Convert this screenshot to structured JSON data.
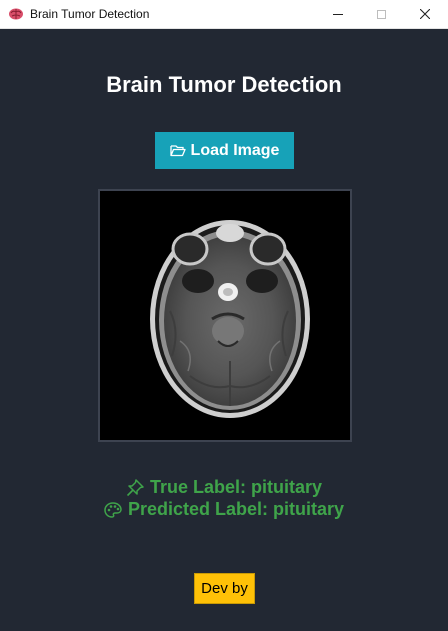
{
  "window": {
    "title": "Brain Tumor Detection"
  },
  "main": {
    "heading": "Brain Tumor Detection",
    "load_button_label": "Load Image",
    "true_label": "True Label: pituitary",
    "predicted_label": "Predicted Label: pituitary",
    "dev_button_label": "Dev by"
  },
  "icons": {
    "app": "brain-icon",
    "load": "folder-open-icon",
    "true_label": "pushpin-icon",
    "predicted_label": "palette-icon"
  },
  "colors": {
    "background": "#222833",
    "accent_button": "#17a2b8",
    "label_green": "#3fa44a",
    "dev_button": "#ffc107"
  }
}
